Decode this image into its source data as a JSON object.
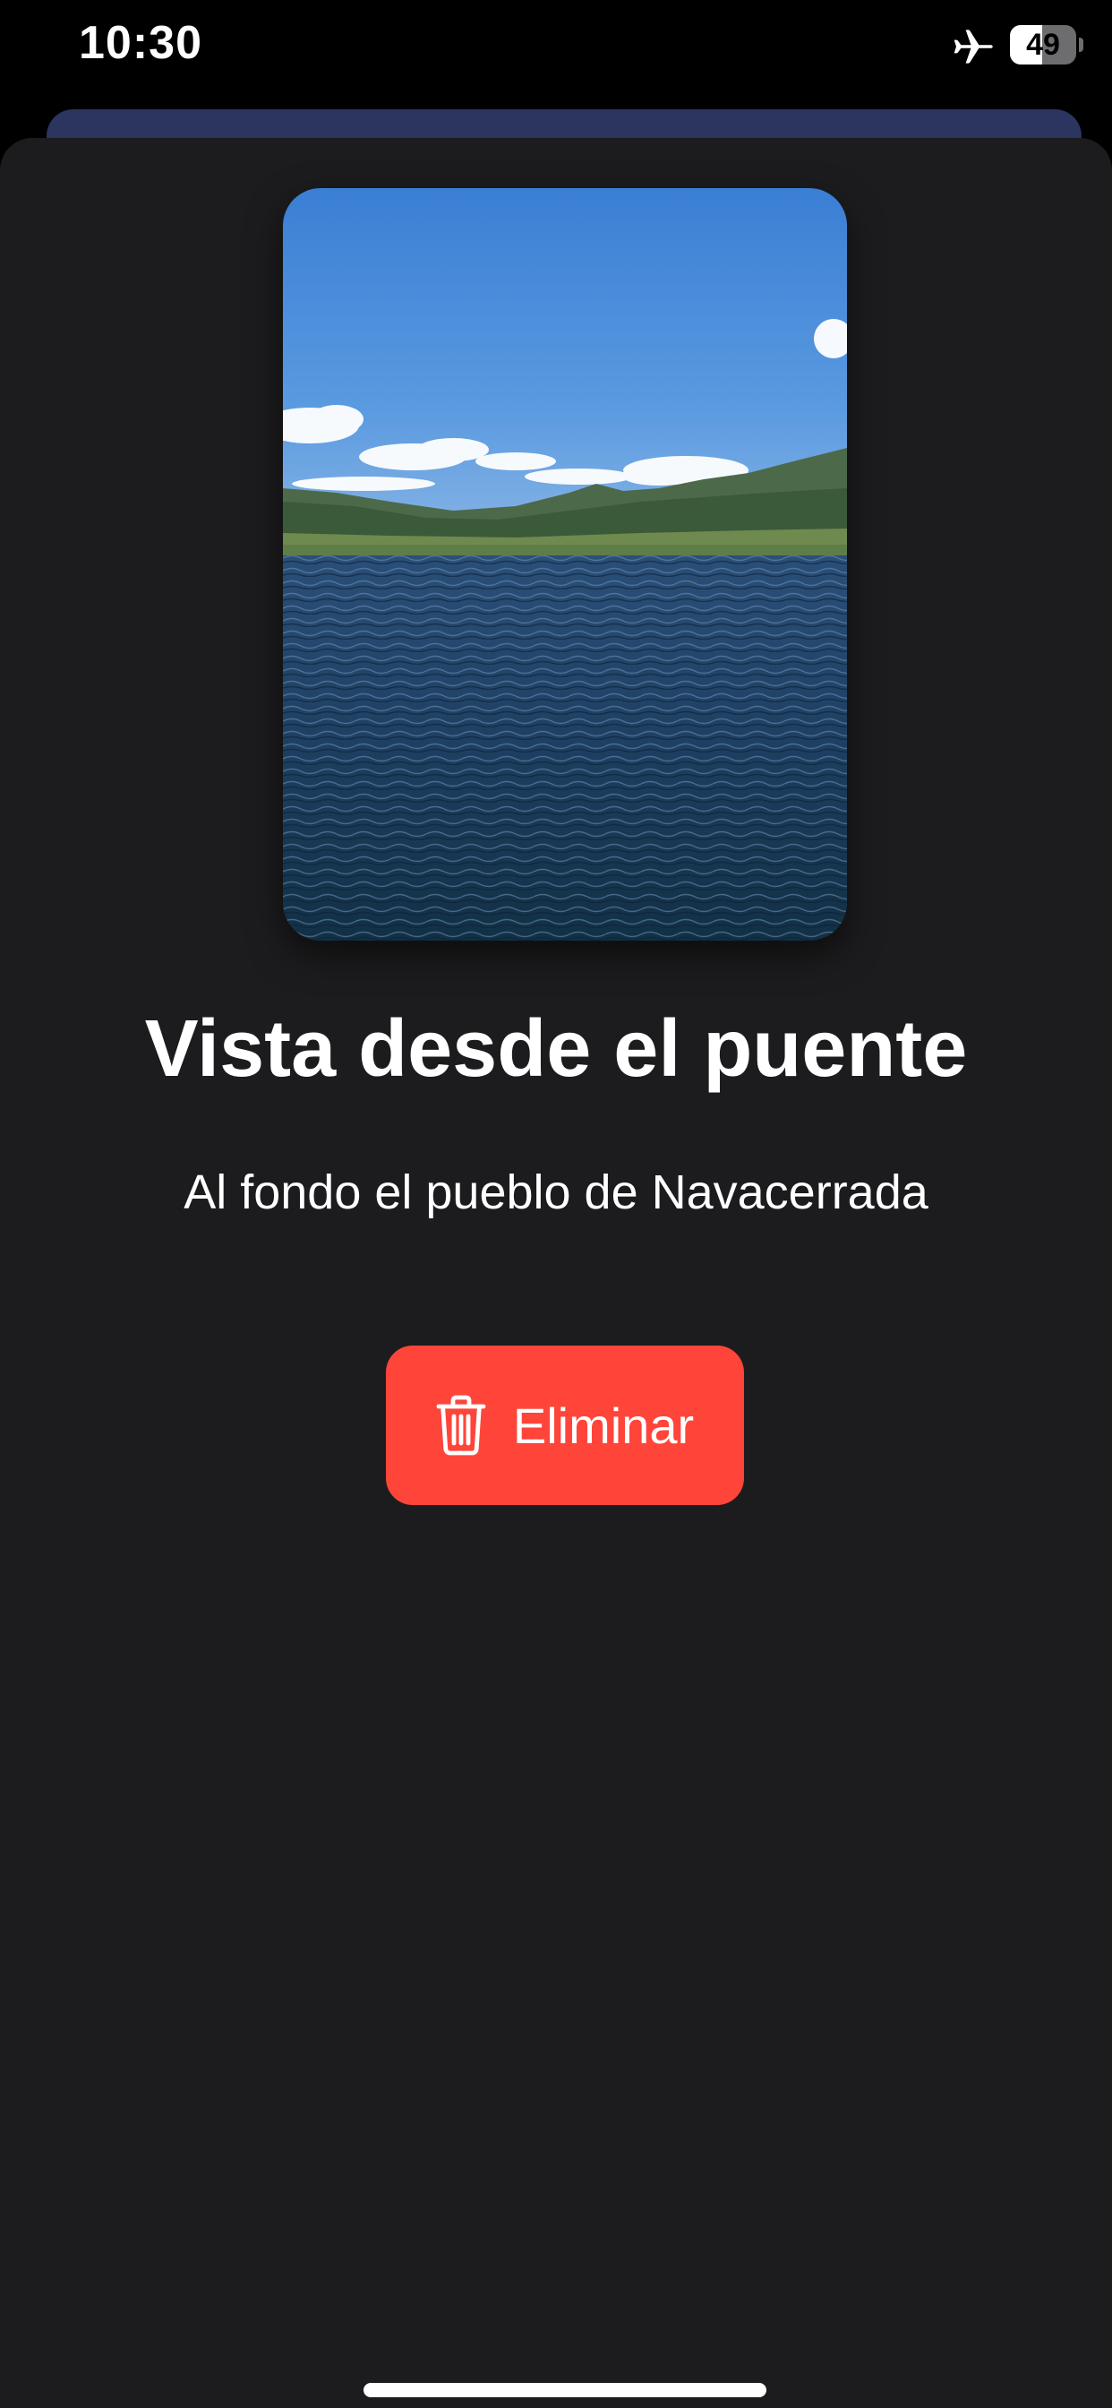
{
  "status_bar": {
    "time": "10:30",
    "battery_level": "49",
    "battery_fraction": 0.49,
    "airplane_mode_icon": "airplane-icon"
  },
  "photo": {
    "description_icon": "landscape-photo"
  },
  "detail": {
    "title": "Vista desde el puente",
    "subtitle": "Al fondo el pueblo de Navacerrada"
  },
  "actions": {
    "delete_label": "Eliminar",
    "delete_icon": "trash-icon"
  },
  "colors": {
    "sheet_background": "#1c1c1e",
    "delete_button": "#ff453a",
    "behind_card": "#2b3560"
  }
}
